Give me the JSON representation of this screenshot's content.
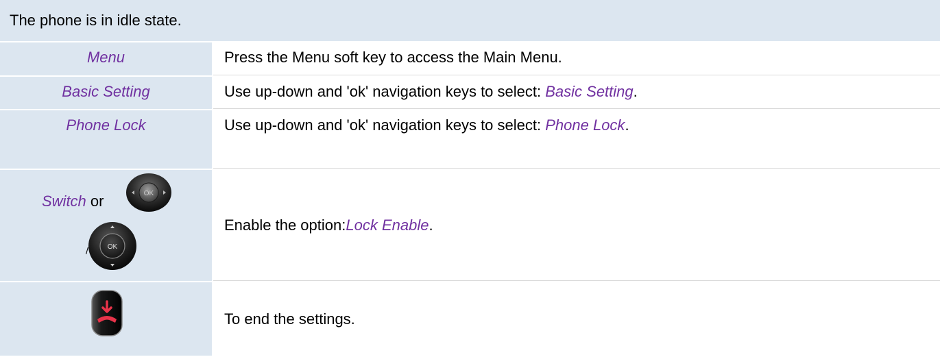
{
  "header": {
    "text": "The phone is in idle state."
  },
  "rows": [
    {
      "left": "Menu",
      "right": "Press the Menu soft key to access the Main Menu."
    },
    {
      "left": "Basic Setting",
      "right_prefix": "Use up-down and 'ok' navigation keys to select: ",
      "right_emph": "Basic Setting",
      "right_suffix": "."
    },
    {
      "left": "Phone Lock",
      "right_prefix": "Use up-down and 'ok' navigation keys to select: ",
      "right_emph": "Phone Lock",
      "right_suffix": "."
    },
    {
      "left_word": "Switch",
      "left_or": "or",
      "left_slash": "/",
      "left_icons": [
        "nav-left-right-ok-key-icon",
        "nav-up-down-ok-key-icon"
      ],
      "ok_label": "OK",
      "right_prefix": "Enable the option: ",
      "right_emph": "Lock Enable",
      "right_suffix": "."
    },
    {
      "left_icon": "end-call-key-icon",
      "right": "To end the settings."
    }
  ],
  "colors": {
    "header_bg": "#dce6f0",
    "left_cell_bg": "#dce6f0",
    "emphasis": "#7030a0",
    "end_key_red": "#e8334a"
  }
}
